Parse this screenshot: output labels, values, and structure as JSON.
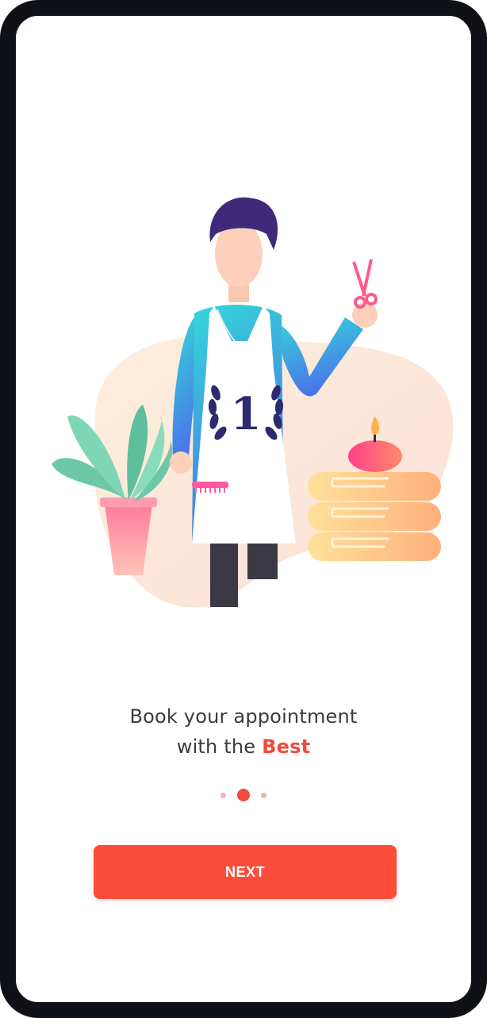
{
  "onboarding": {
    "headline_line1": "Book your appointment",
    "headline_line2_prefix": "with the ",
    "headline_line2_accent": "Best",
    "badge_number": "1",
    "pager": {
      "total": 3,
      "active_index": 1
    },
    "next_label": "NEXT"
  },
  "colors": {
    "accent": "#fc4d3a",
    "frame": "#0f1117",
    "text": "#3a3a40"
  },
  "icons": [
    "barber-illustration",
    "laurel-badge-icon",
    "scissors-icon",
    "comb-icon",
    "plant-icon",
    "candle-icon",
    "towel-stack-icon"
  ]
}
